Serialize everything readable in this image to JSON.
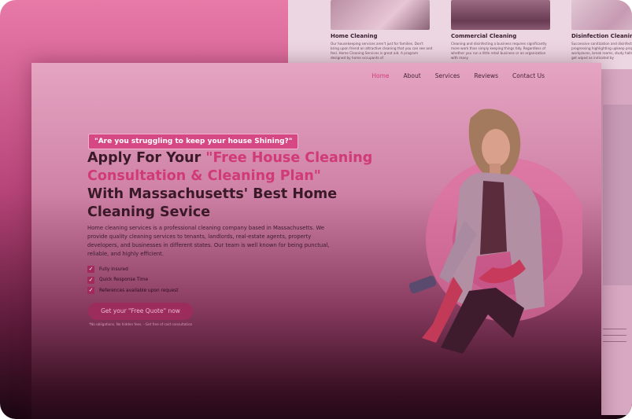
{
  "back_page": {
    "services": [
      {
        "title": "Home Cleaning",
        "desc": "Our housekeeping services aren't just for families. Don't bring upon friend an attractive cleaning that you can see and feel. Home Cleaning Services is great aid. A program designed by home occupants of"
      },
      {
        "title": "Commercial Cleaning",
        "desc": "Cleaning and disinfecting a business requires significantly more work than simply keeping things tidy. Regardless of whether you run a little retail business or an organization with many"
      },
      {
        "title": "Disinfection Cleaning",
        "desc": "Successive sanitization and disinfection of offices are progressing highlighting upkeep program, all offices, workplaces, break rooms, study halls, halls and washrooms get wiped as indicated by"
      }
    ]
  },
  "nav": {
    "items": [
      "Home",
      "About",
      "Services",
      "Reviews",
      "Contact Us"
    ],
    "active": "Home"
  },
  "hero": {
    "tag": "\"Are you struggling to keep your house Shining?\"",
    "title_part1": "Apply For Your ",
    "title_highlight": "\"Free House Cleaning Consultation & Cleaning Plan\"",
    "title_part2": "With Massachusetts' Best Home Cleaning Sevice",
    "lead": "Home cleaning services is a professional cleaning company based in Massachusetts. We provide quality cleaning services to tenants, landlords, real-estate agents, property developers, and businesses in different states. Our team is well known for being punctual, reliable, and highly efficient.",
    "checks": [
      "Fully Insured",
      "Quick Response Time",
      "References available upon request"
    ],
    "cta": "Get your \"Free Quote\" now",
    "fine_print": "*No obligations. No hidden fees. - Get free of cost consultation"
  },
  "colors": {
    "accent": "#d03a76",
    "nav_active": "#d23a78",
    "cta_bg": "#9c2c5c"
  }
}
